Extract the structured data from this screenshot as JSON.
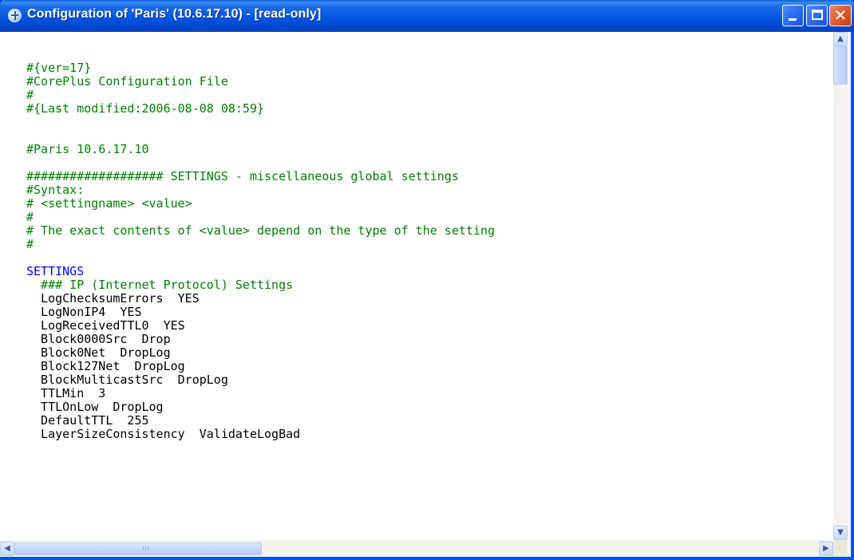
{
  "window": {
    "title": "Configuration of 'Paris' (10.6.17.10) - [read-only]",
    "close_glyph": "✕"
  },
  "lines": [
    {
      "text": "",
      "style": "plain"
    },
    {
      "text": "#{ver=17}",
      "style": "cmt"
    },
    {
      "text": "#CorePlus Configuration File",
      "style": "cmt"
    },
    {
      "text": "#",
      "style": "cmt"
    },
    {
      "text": "#{Last modified:2006-08-08 08:59}",
      "style": "cmt"
    },
    {
      "text": "",
      "style": "plain"
    },
    {
      "text": "",
      "style": "plain"
    },
    {
      "text": "#Paris 10.6.17.10",
      "style": "cmt"
    },
    {
      "text": "",
      "style": "plain"
    },
    {
      "text": "################### SETTINGS - miscellaneous global settings",
      "style": "cmt"
    },
    {
      "text": "#Syntax:",
      "style": "cmt"
    },
    {
      "text": "# <settingname> <value>",
      "style": "cmt"
    },
    {
      "text": "#",
      "style": "cmt"
    },
    {
      "text": "# The exact contents of <value> depend on the type of the setting",
      "style": "cmt"
    },
    {
      "text": "#",
      "style": "cmt"
    },
    {
      "text": "",
      "style": "plain"
    },
    {
      "text": "SETTINGS",
      "style": "kw"
    },
    {
      "text": "  ### IP (Internet Protocol) Settings",
      "style": "cmt"
    },
    {
      "text": "  LogChecksumErrors  YES",
      "style": "plain"
    },
    {
      "text": "  LogNonIP4  YES",
      "style": "plain"
    },
    {
      "text": "  LogReceivedTTL0  YES",
      "style": "plain"
    },
    {
      "text": "  Block0000Src  Drop",
      "style": "plain"
    },
    {
      "text": "  Block0Net  DropLog",
      "style": "plain"
    },
    {
      "text": "  Block127Net  DropLog",
      "style": "plain"
    },
    {
      "text": "  BlockMulticastSrc  DropLog",
      "style": "plain"
    },
    {
      "text": "  TTLMin  3",
      "style": "plain"
    },
    {
      "text": "  TTLOnLow  DropLog",
      "style": "plain"
    },
    {
      "text": "  DefaultTTL  255",
      "style": "plain"
    },
    {
      "text": "  LayerSizeConsistency  ValidateLogBad",
      "style": "plain"
    }
  ],
  "scroll": {
    "up_arrow": "▲",
    "down_arrow": "▼",
    "left_arrow": "◀",
    "right_arrow": "▶",
    "grip": "III",
    "corner_dots": ".:"
  }
}
